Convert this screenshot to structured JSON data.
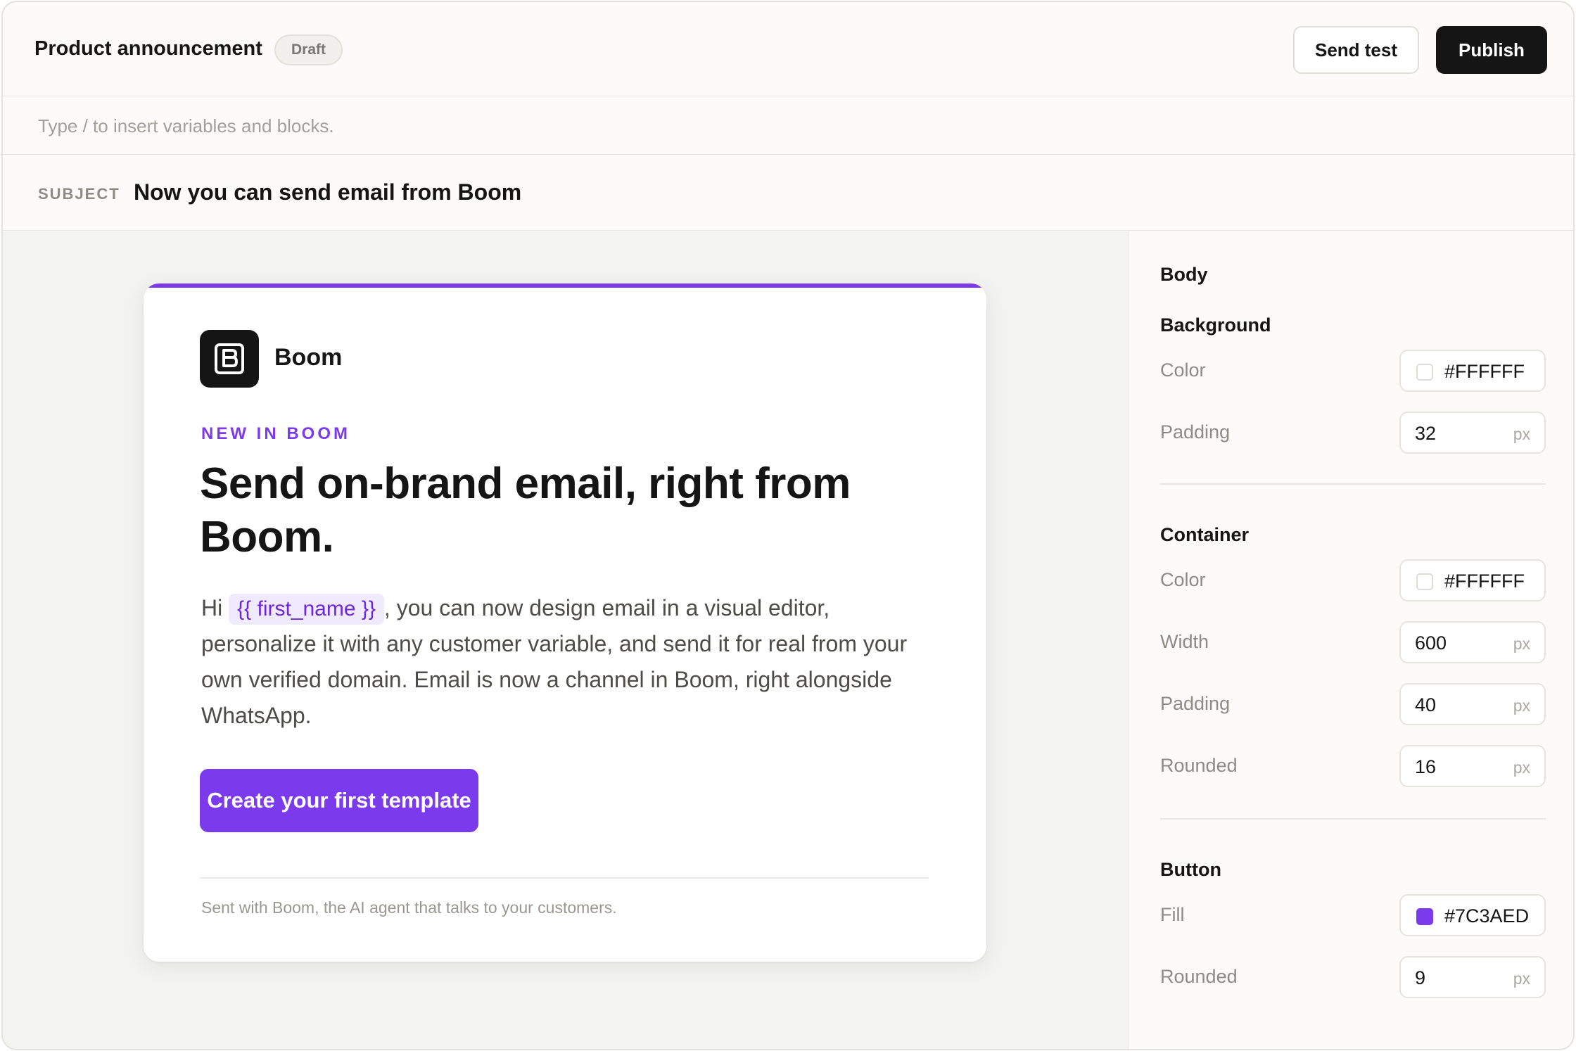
{
  "header": {
    "title": "Product announcement",
    "status_badge": "Draft",
    "send_test_label": "Send test",
    "publish_label": "Publish"
  },
  "editor": {
    "hint": "Type / to insert variables and blocks.",
    "subject_label": "SUBJECT",
    "subject_value": "Now you can send email from Boom"
  },
  "email": {
    "accent_color": "#7C3AED",
    "brand_name": "Boom",
    "eyebrow": "NEW IN BOOM",
    "headline": "Send on-brand email, right from Boom.",
    "greeting": "Hi",
    "variable": "{{ first_name }}",
    "body": ", you can now design email in a visual editor, personalize it with any customer variable, and send it for real from your own verified domain. Email is now a channel in Boom, right alongside WhatsApp.",
    "cta_label": "Create your first template",
    "footer": "Sent with Boom, the AI agent that talks to your customers."
  },
  "panel": {
    "title": "Body",
    "background": {
      "heading": "Background",
      "color_label": "Color",
      "color_value": "#FFFFFF",
      "padding_label": "Padding",
      "padding_value": "32",
      "unit": "px"
    },
    "container": {
      "heading": "Container",
      "color_label": "Color",
      "color_value": "#FFFFFF",
      "width_label": "Width",
      "width_value": "600",
      "padding_label": "Padding",
      "padding_value": "40",
      "rounded_label": "Rounded",
      "rounded_value": "16",
      "unit": "px"
    },
    "button": {
      "heading": "Button",
      "fill_label": "Fill",
      "fill_value": "#7C3AED",
      "rounded_label": "Rounded",
      "rounded_value": "9",
      "unit": "px"
    }
  }
}
